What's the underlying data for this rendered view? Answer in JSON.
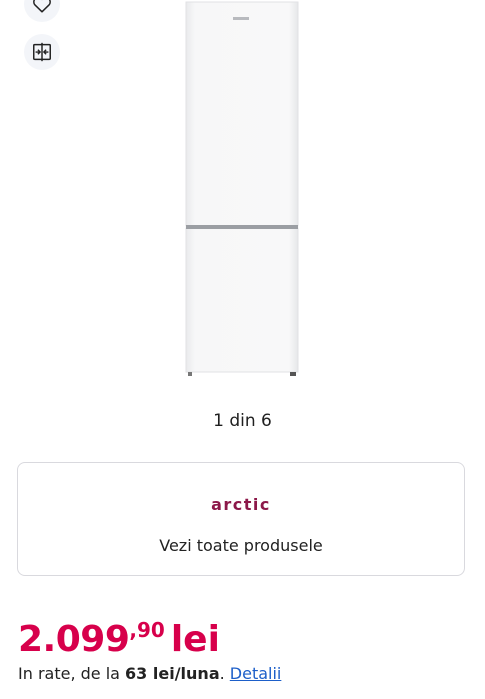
{
  "actions": {
    "wishlist_icon": "heart-icon",
    "compare_icon": "compare-icon"
  },
  "gallery": {
    "counter": "1 din 6"
  },
  "brand_card": {
    "logo_text": "arctic",
    "link_label": "Vezi toate produsele",
    "logo_color": "#8c1849"
  },
  "price": {
    "integer": "2.099",
    "decimals": ",90",
    "currency": "lei",
    "color": "#d7004b"
  },
  "installment": {
    "prefix": "In rate, de la ",
    "amount": "63 lei/luna",
    "suffix": ". ",
    "details_link": "Detalii"
  }
}
